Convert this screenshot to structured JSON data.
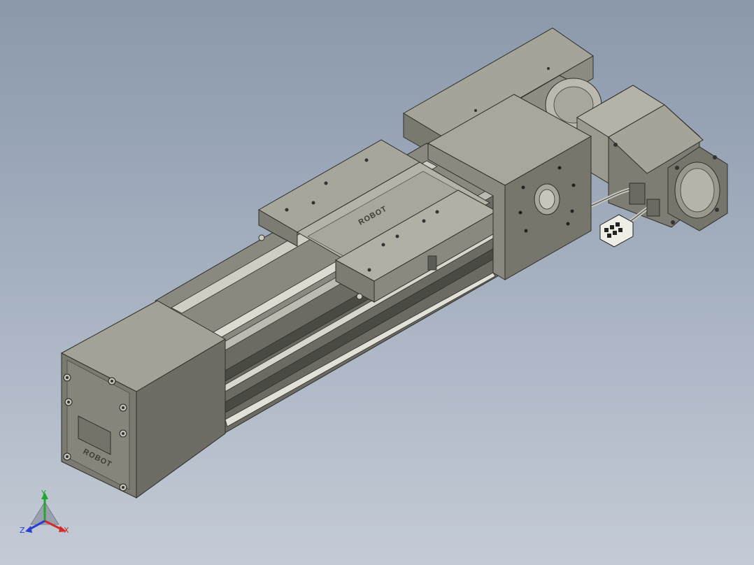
{
  "viewer": {
    "background_top": "#8b99ab",
    "background_bottom": "#c4cbd6"
  },
  "model": {
    "brand_logo": "ROBOT",
    "colors": {
      "body_top": "#a09f92",
      "body_front": "#6e6e66",
      "body_side": "#8a8a80",
      "dark_face": "#5a5a54",
      "rail": "#c9c9c0",
      "motor": "#b8b6a8",
      "connector": "#e8e8e0"
    }
  },
  "triad": {
    "x_label": "X",
    "y_label": "Y",
    "z_label": "Z",
    "x_color": "#d22a2a",
    "y_color": "#22a632",
    "z_color": "#2a3fd2"
  }
}
